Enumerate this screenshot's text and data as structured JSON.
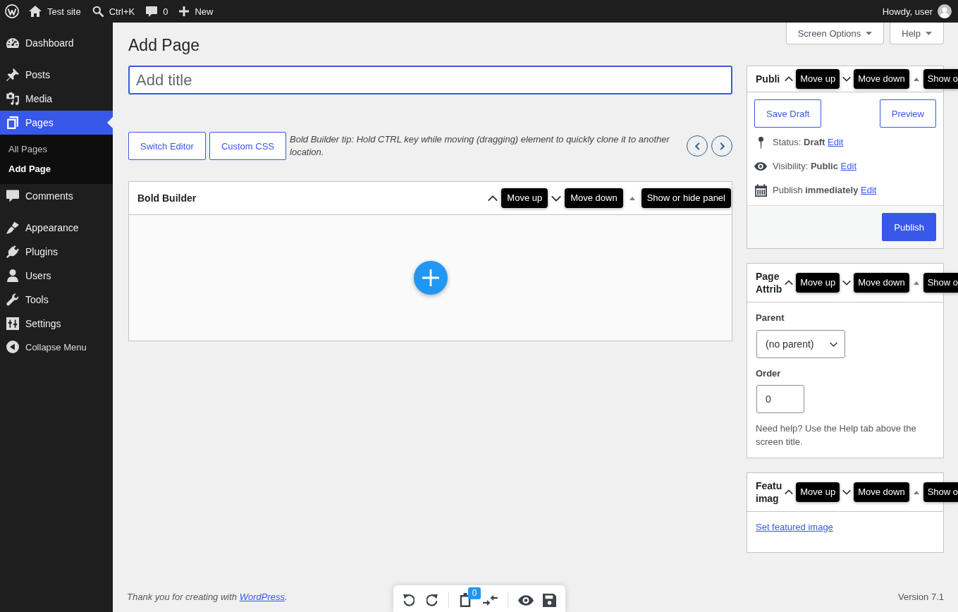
{
  "admin_bar": {
    "site_name": "Test site",
    "search_shortcut": "Ctrl+K",
    "comment_count": "0",
    "new_label": "New",
    "greeting": "Howdy, user"
  },
  "sidebar": {
    "groups": [
      {
        "items": [
          {
            "label": "Dashboard",
            "selected": false
          }
        ]
      },
      {
        "items": [
          {
            "label": "Posts",
            "selected": false
          },
          {
            "label": "Media",
            "selected": false
          },
          {
            "label": "Pages",
            "selected": true,
            "children": [
              {
                "label": "All Pages",
                "selected": false
              },
              {
                "label": "Add Page",
                "selected": true
              }
            ]
          },
          {
            "label": "Comments",
            "selected": false
          }
        ]
      },
      {
        "items": [
          {
            "label": "Appearance",
            "selected": false
          },
          {
            "label": "Plugins",
            "selected": false
          },
          {
            "label": "Users",
            "selected": false
          },
          {
            "label": "Tools",
            "selected": false
          },
          {
            "label": "Settings",
            "selected": false
          }
        ]
      }
    ],
    "collapse_label": "Collapse Menu"
  },
  "screen_meta": [
    "Screen Options",
    "Help"
  ],
  "heading": "Add Page",
  "title_field": {
    "placeholder": "Add title"
  },
  "builder_bar": {
    "buttons": [
      "Switch Editor",
      "Custom CSS"
    ],
    "tip": "Bold Builder tip: Hold CTRL key while moving (dragging) element to quickly clone it to another location."
  },
  "builder_panel": {
    "title": "Bold Builder",
    "tooltips": [
      "Move up",
      "Move down",
      "Show or hide panel"
    ]
  },
  "publish_box": {
    "title": "Publi",
    "tooltips": [
      "Move up",
      "Move down",
      "Show o"
    ],
    "save_draft": "Save Draft",
    "preview": "Preview",
    "rows": [
      {
        "text": "Status: **Draft**",
        "link": "Edit"
      },
      {
        "text": "Visibility: **Public**",
        "link": "Edit"
      },
      {
        "text": "Publish **immediately**",
        "link": "Edit"
      }
    ],
    "publish": "Publish"
  },
  "page_attributes": {
    "title": "Page Attrib",
    "tooltips": [
      "Move up",
      "Move down",
      "Show o"
    ],
    "parent_label": "Parent",
    "parent_value": "(no parent)",
    "order_label": "Order",
    "order_value": "0",
    "help": "Need help? Use the Help tab above the screen title."
  },
  "featured_image": {
    "title": "Featu imag",
    "tooltips": [
      "Move up",
      "Move down",
      "Show o"
    ],
    "link": "Set featured image"
  },
  "footer": {
    "thanks": "Thank you for creating with ",
    "thanks_link": "WordPress",
    "thanks_end": ".",
    "version": "Version 7.1"
  },
  "float_toolbar": {
    "clipboard_count": "0"
  }
}
